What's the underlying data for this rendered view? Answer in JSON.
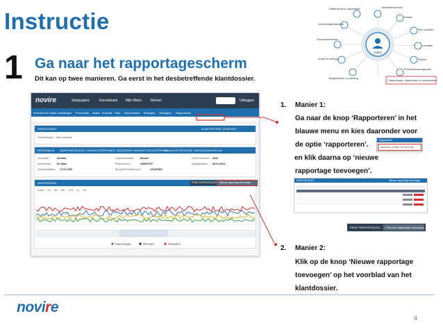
{
  "header": {
    "title": "Instructie",
    "step_number": "1",
    "step_title": "Ga naar het rapportagescherm",
    "step_subtitle": "Dit kan op twee manieren. Ga eerst in het desbetreffende klantdossier."
  },
  "hub": {
    "center": "Klant",
    "nodes": [
      "Medicatieoverzicht",
      "Dossier",
      "Plan opstellen",
      "Indicaties",
      "Planner",
      "Personeelsmanagement",
      "Budgetbeheer en planning",
      "Audits en toetsing",
      "Documentenbeheer",
      "Voorlichtingsmaterialen",
      "Dashboards en rapportages"
    ],
    "highlight": "Rapportages, registraties en dossieritems"
  },
  "screenshot": {
    "logo": "novire",
    "top_tabs": [
      "Startpagina",
      "Kennisbank",
      "Mijn Menu",
      "Beheer"
    ],
    "logout": "Uitloggen",
    "nav_items": [
      "Overzicht en Vaste",
      "Instellingen",
      "Personalia",
      "Intake",
      "Indicatie",
      "Plan",
      "Documenten",
      "Metingen",
      "Verslagen",
      "Rapporteren"
    ],
    "panel_header": "VERHOUDING",
    "panel_action": "KLANTPROFIEL WIJZIGEN",
    "panel_row": "Subafdelingen : Jaap Cheniaak",
    "tabs": [
      "PERSONALIA",
      "ADRESGEGEVENS",
      "CONTACTPERSONEN",
      "GEGEVENS HUISARTS EN APOTHEEK",
      "AANDACHTSPUNTEN",
      "BEGELEIDINGSPLAN"
    ],
    "person_fields": [
      [
        "Voornaam:",
        "Hendrik",
        "Zorgverzekeraar:",
        "Menzis",
        "UZOVI nummer:",
        "3332"
      ],
      [
        "Achternaam:",
        "de Haan",
        "Polisnummer:",
        "238092147",
        "Ingangsdatum:",
        "28-01-2014"
      ],
      [
        "Geboortedatum:",
        "17-01-1936",
        "BurgerServiceNummer:",
        "121187963",
        "",
        ""
      ]
    ],
    "chart_header": "RAPPORTAGE",
    "chart_buttons": [
      "PRINT RAPPORTAGES",
      "Nieuwe rapportage toevoegen"
    ],
    "zoom_options": [
      "Zoom",
      "1m",
      "3m",
      "6m",
      "YTD",
      "1y",
      "All"
    ],
    "legend": [
      "Rapportages",
      "Metingen",
      "Afspraken"
    ]
  },
  "instructions": {
    "manier1_num": "1.",
    "manier1_label": "Manier 1:",
    "manier1_lines": [
      "Ga naar de knop ‘Rapporteren’ in het",
      "blauwe menu en kies daaronder voor",
      "de optie ‘rapporteren’.",
      "en klik daarna op ‘nieuwe",
      "rapportage toevoegen’."
    ],
    "manier2_num": "2.",
    "manier2_label": "Manier 2:",
    "manier2_lines": [
      "Klik op de knop ‘Nieuwe rapportage",
      "toevoegen’ op het voorblad van het",
      "klantdossier."
    ]
  },
  "snippets": {
    "menu_items": [
      "Rapporteren",
      "Rapporteer: Subafd. van deze dag"
    ],
    "table_title": "RAPPORTAGES",
    "table_action": "Nieuwe rapportage toevoegen",
    "button_print": "PRINT RAPPORTAGES",
    "button_new": "+ Nieuwe rapportage toevoegen"
  },
  "footer": {
    "logo_prefix": "novi",
    "logo_accent": "r",
    "logo_suffix": "e",
    "page_number": "4"
  },
  "colors": {
    "brand_blue": "#1f6faf",
    "dark_nav": "#2c3e50",
    "accent_red": "#d62c2c"
  }
}
